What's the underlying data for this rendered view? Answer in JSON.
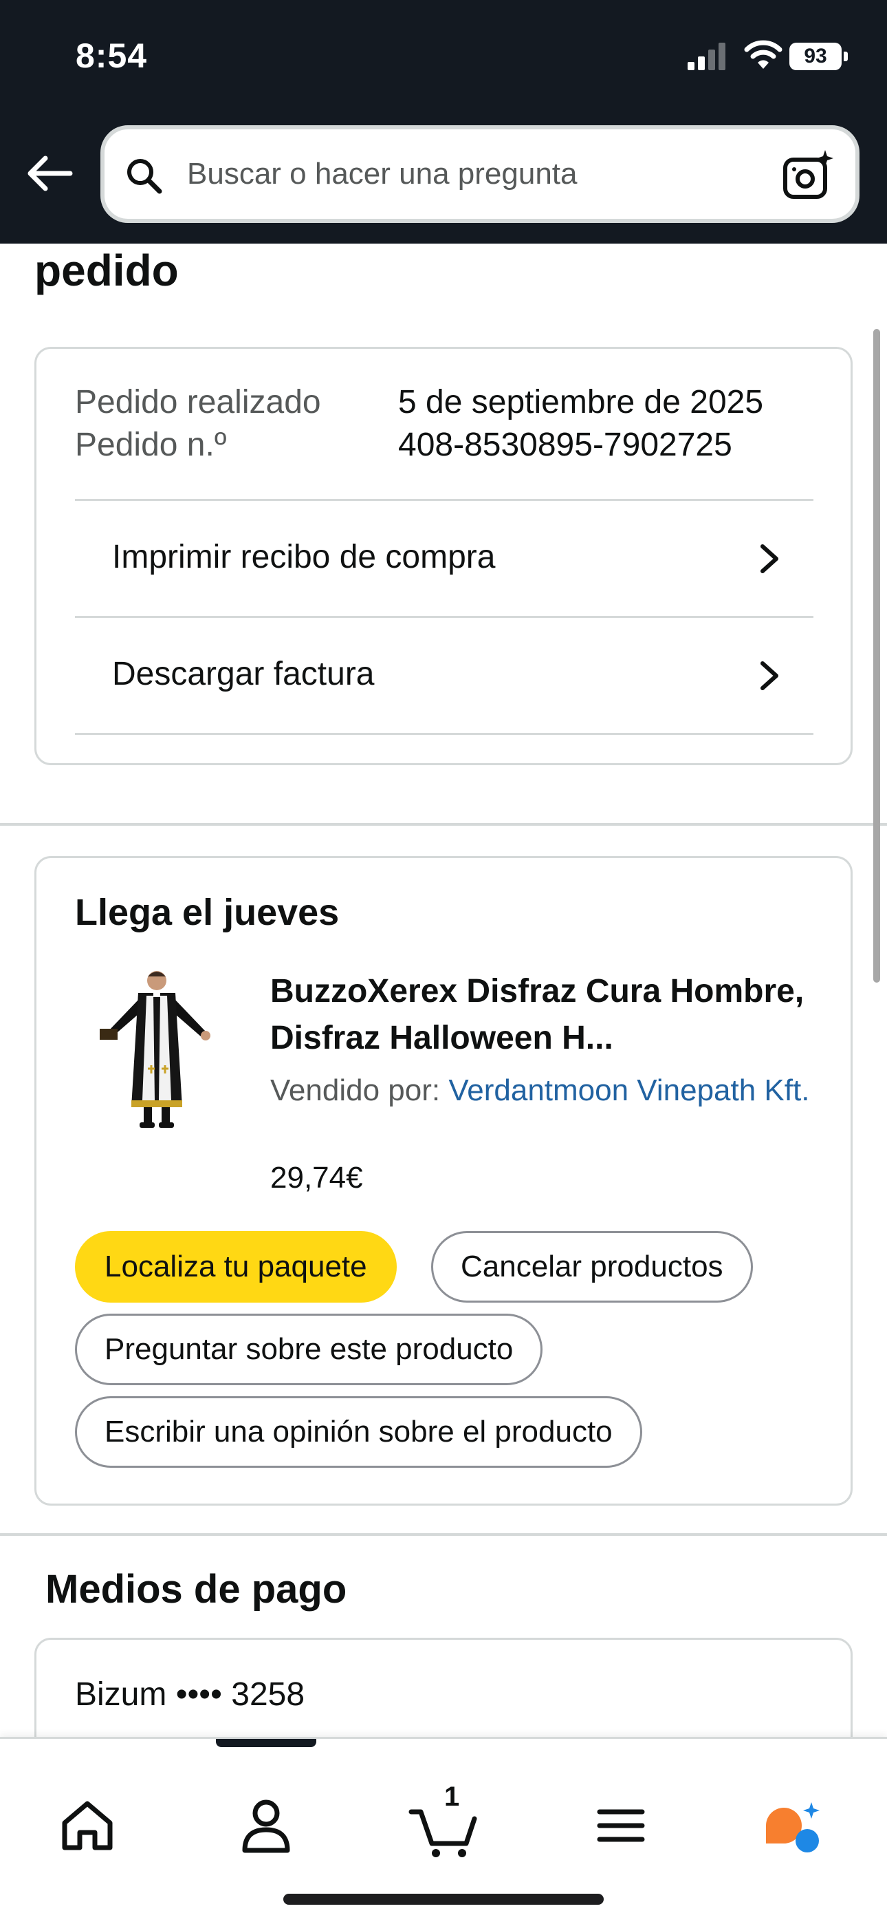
{
  "status_bar": {
    "time": "8:54",
    "battery": "93"
  },
  "header": {
    "search_placeholder": "Buscar o hacer una pregunta"
  },
  "page": {
    "heading": "pedido"
  },
  "order_summary": {
    "placed_label": "Pedido realizado",
    "placed_value": "5 de septiembre de 2025",
    "number_label": "Pedido n.º",
    "number_value": "408-8530895-7902725",
    "actions": [
      {
        "label": "Imprimir recibo de compra"
      },
      {
        "label": "Descargar factura"
      }
    ]
  },
  "shipment": {
    "title": "Llega el jueves",
    "product": {
      "title": "BuzzoXerex Disfraz Cura Hombre, Disfraz Halloween H...",
      "sold_by_label": "Vendido por:",
      "seller": "Verdantmoon Vinepath Kft.",
      "price": "29,74€"
    },
    "buttons": {
      "track": "Localiza tu paquete",
      "cancel": "Cancelar productos",
      "ask": "Preguntar sobre este producto",
      "review": "Escribir una opinión sobre el producto"
    }
  },
  "payment": {
    "heading": "Medios de pago",
    "method": "Bizum •••• 3258"
  },
  "bottom_nav": {
    "cart_count": "1",
    "items": [
      "home-icon",
      "account-icon",
      "cart-icon",
      "menu-icon",
      "rufus-assistant-icon"
    ]
  },
  "colors": {
    "header_bg": "#131921",
    "primary_button": "#ffd814",
    "link": "#2162a1",
    "muted_text": "#565959",
    "assistant_orange": "#f77f2f",
    "assistant_blue": "#1e88e5"
  }
}
